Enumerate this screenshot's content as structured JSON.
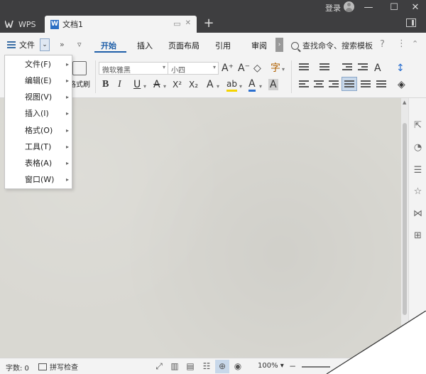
{
  "titlebar": {
    "app_tab_label": "WPS",
    "doc_tab_label": "文档1",
    "new_tab_symbol": "+",
    "login_label": "登录",
    "minimize_symbol": "—",
    "maximize_symbol": "☐",
    "close_symbol": "✕"
  },
  "menubar": {
    "file_label": "文件",
    "file_dropdown_symbol": "⌄",
    "overflow_symbol": "»",
    "quick_dropdown_symbol": "▿",
    "tabs": [
      {
        "label": "开始",
        "active": true
      },
      {
        "label": "插入",
        "active": false
      },
      {
        "label": "页面布局",
        "active": false
      },
      {
        "label": "引用",
        "active": false
      },
      {
        "label": "审阅",
        "active": false
      }
    ],
    "more_tabs_symbol": "›",
    "search_label": "查找命令、搜索模板",
    "help_symbol": "?",
    "more_symbol": "⋮",
    "collapse_symbol": "⌃"
  },
  "toolbar": {
    "format_painter_label": "格式刷",
    "font_name": "微软雅黑",
    "font_size": "小四",
    "increase_font": "A⁺",
    "decrease_font": "A⁻",
    "clear_format": "◇",
    "phonetic": "字",
    "bold": "B",
    "italic": "I",
    "underline": "U",
    "strikethrough": "A",
    "superscript": "X²",
    "subscript": "X₂",
    "text_effect": "A",
    "highlight": "ab",
    "font_color": "A",
    "char_shading": "A",
    "dropdown_symbol": "▾"
  },
  "dropdown_menu": {
    "items": [
      {
        "label": "文件(F)"
      },
      {
        "label": "编辑(E)"
      },
      {
        "label": "视图(V)"
      },
      {
        "label": "插入(I)"
      },
      {
        "label": "格式(O)"
      },
      {
        "label": "工具(T)"
      },
      {
        "label": "表格(A)"
      },
      {
        "label": "窗口(W)"
      }
    ],
    "submenu_symbol": "▸"
  },
  "statusbar": {
    "word_count": "字数: 0",
    "spell_check": "拼写检查",
    "zoom": "100%",
    "zoom_dropdown": "▾",
    "zoom_out": "−"
  },
  "colors": {
    "accent": "#1f5fa8",
    "titlebar_bg": "#3e3e40",
    "ribbon_bg": "#f3f3f3",
    "document_bg": "#d9d8d2",
    "font_color_bar": "#2a6fd0",
    "highlight_bar": "#f5d400"
  }
}
